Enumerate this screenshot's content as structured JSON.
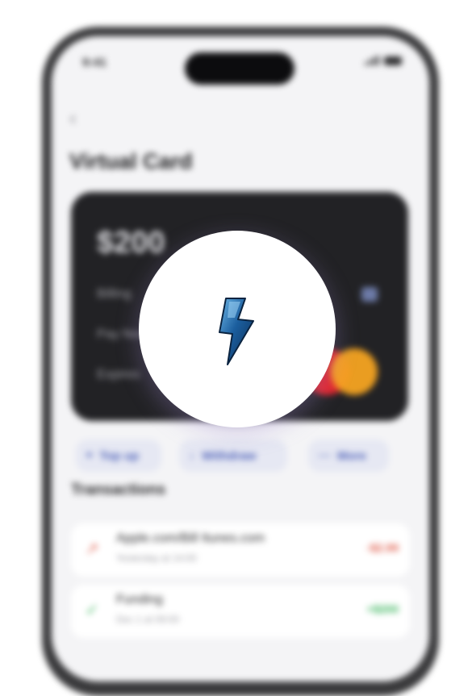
{
  "status": {
    "time": "9:41"
  },
  "header": {
    "back_icon": "chevron-left-icon",
    "title": "Virtual Card"
  },
  "card": {
    "balance": "$200",
    "line1": "Billing",
    "line2": "Pay Now",
    "line3": "Expires",
    "brand_icon": "mastercard-logo"
  },
  "actions": [
    {
      "icon": "plus-icon",
      "label": "Top up"
    },
    {
      "icon": "arrow-down-icon",
      "label": "Withdraw"
    },
    {
      "icon": "dots-icon",
      "label": "More"
    }
  ],
  "transactions": {
    "title": "Transactions",
    "items": [
      {
        "icon": "arrow-up-icon",
        "title": "Apple.com/Bill Itunes.com",
        "subtitle": "Yesterday at 14:00",
        "amount": "-$2.99",
        "color": "#e0604f"
      },
      {
        "icon": "check-icon",
        "title": "Funding",
        "subtitle": "Dec 1 at 09:00",
        "amount": "+$200",
        "color": "#38b45a"
      }
    ]
  },
  "overlay": {
    "icon": "lightning-bolt-icon",
    "accent": "#1f6fb2"
  }
}
